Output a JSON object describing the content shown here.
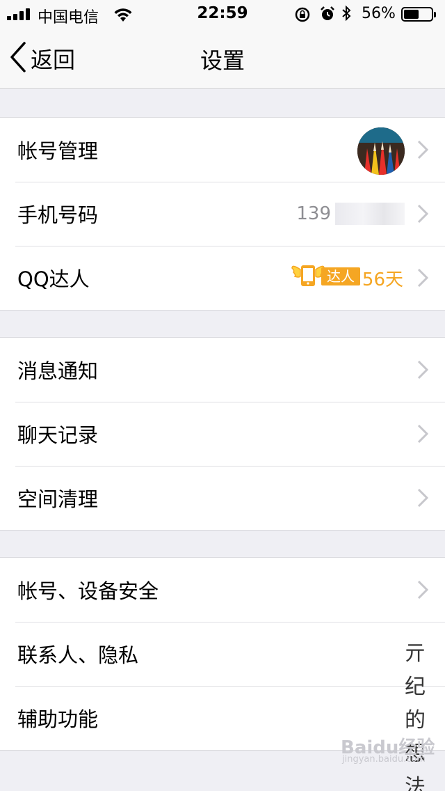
{
  "status_bar": {
    "carrier": "中国电信",
    "time": "22:59",
    "battery_percent": "56%",
    "battery_level": 0.56
  },
  "nav": {
    "back_label": "返回",
    "title": "设置"
  },
  "groups": [
    {
      "rows": [
        {
          "label": "帐号管理"
        },
        {
          "label": "手机号码",
          "value": "139"
        },
        {
          "label": "QQ达人",
          "badge": "达人",
          "value": "56天"
        }
      ]
    },
    {
      "rows": [
        {
          "label": "消息通知"
        },
        {
          "label": "聊天记录"
        },
        {
          "label": "空间清理"
        }
      ]
    },
    {
      "rows": [
        {
          "label": "帐号、设备安全"
        },
        {
          "label": "联系人、隐私"
        },
        {
          "label": "辅助功能"
        }
      ]
    }
  ],
  "watermark": {
    "chars": [
      "亓",
      "纪",
      "的",
      "想",
      "法"
    ],
    "site": "Baidu经验",
    "site_url": "jingyan.baidu.com"
  },
  "colors": {
    "accent_orange": "#f5a623",
    "background": "#efeff4",
    "chevron": "#c7c7cc"
  }
}
